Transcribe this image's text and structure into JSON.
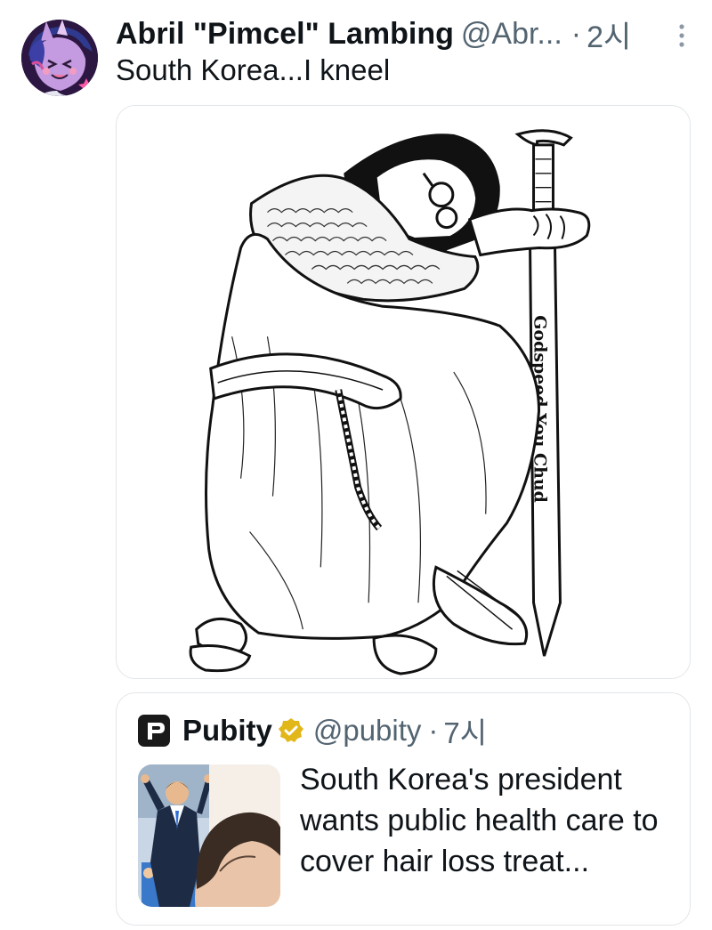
{
  "tweet": {
    "display_name": "Abril \"Pimcel\" Lambing",
    "handle": "@Abr...",
    "separator": "·",
    "time": "2시",
    "text": "South Korea...I kneel",
    "avatar_icon": "avatar-pony-icon",
    "more_icon": "more-vertical-icon"
  },
  "media": {
    "sword_inscription": "Godspeed You Chud"
  },
  "quote": {
    "name": "Pubity",
    "handle": "@pubity",
    "separator": "·",
    "time": "7시",
    "text": "South Korea's president wants public health care to cover hair loss treat...",
    "logo_icon": "pubity-logo-icon",
    "badge_icon": "verified-gold-badge-icon",
    "badge_color": "#e2b719"
  },
  "colors": {
    "text_primary": "#0f1419",
    "text_secondary": "#536471",
    "border": "#e1e6ea"
  }
}
